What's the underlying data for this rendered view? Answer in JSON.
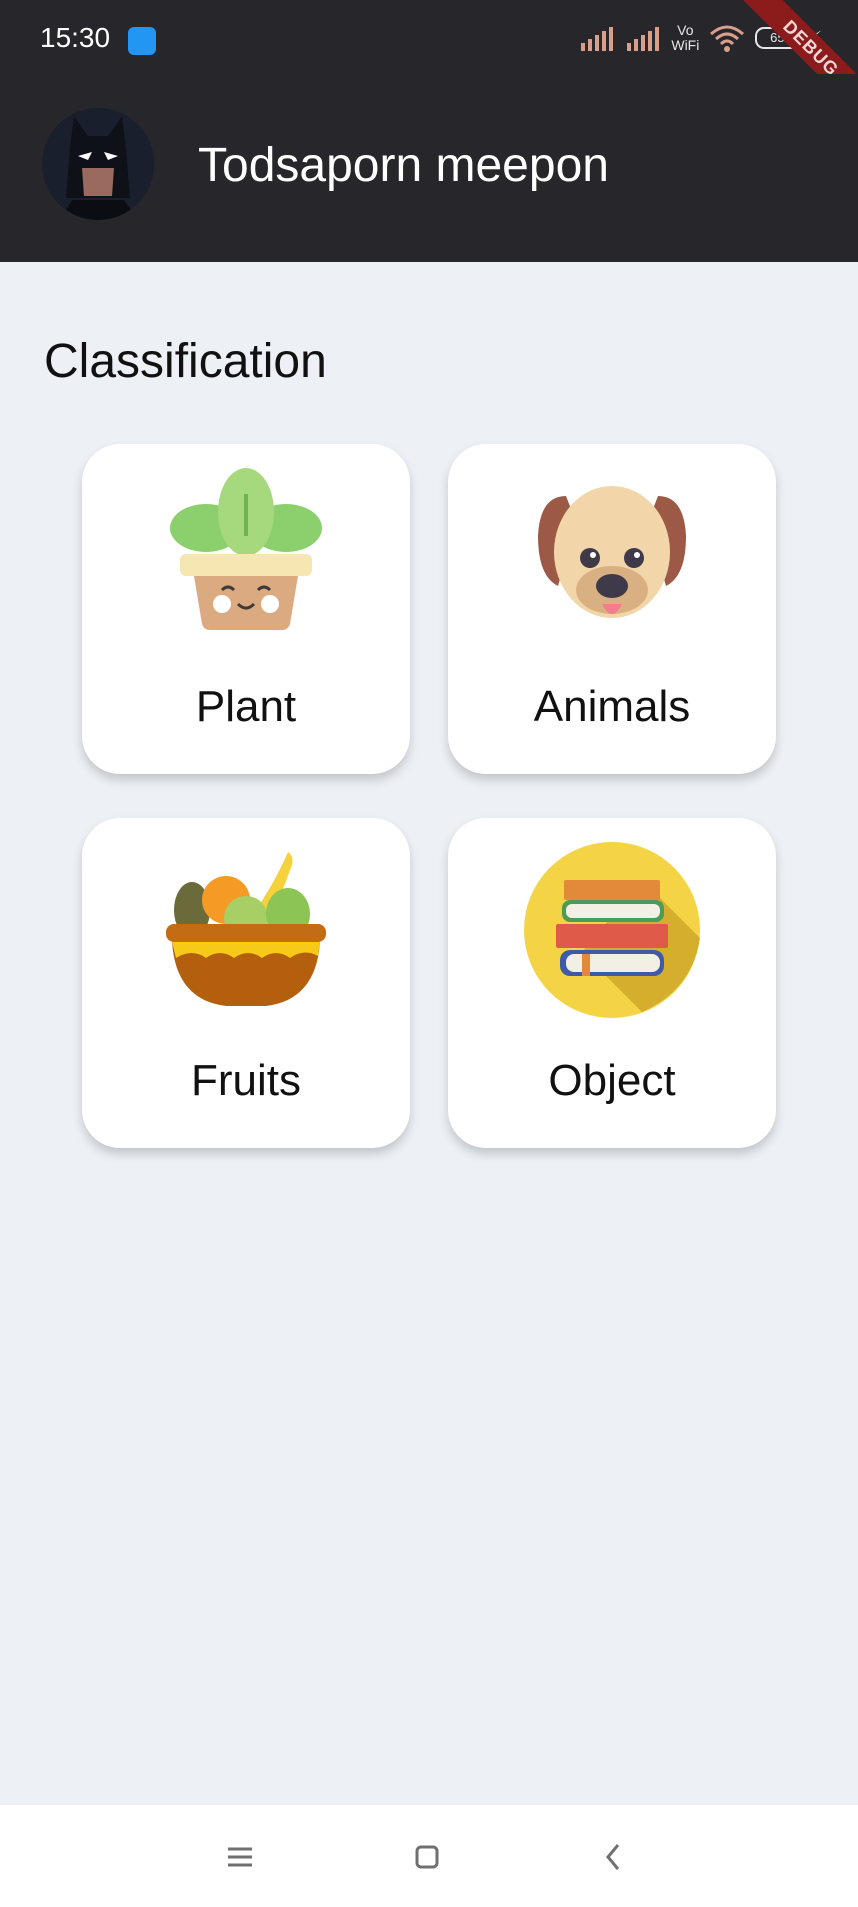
{
  "status_bar": {
    "time": "15:30",
    "vowifi_top": "Vo",
    "vowifi_bottom": "WiFi",
    "battery": "65",
    "debug_label": "DEBUG"
  },
  "app_bar": {
    "user_name": "Todsaporn meepon",
    "avatar_icon": "batman-avatar"
  },
  "main": {
    "section_title": "Classification",
    "categories": [
      {
        "label": "Plant",
        "icon": "potted-plant-icon"
      },
      {
        "label": "Animals",
        "icon": "dog-face-icon"
      },
      {
        "label": "Fruits",
        "icon": "fruit-basket-icon"
      },
      {
        "label": "Object",
        "icon": "books-icon"
      }
    ]
  },
  "colors": {
    "bar_background": "#26262b",
    "page_background": "#edf1f6",
    "card_background": "#ffffff",
    "debug_ribbon": "#8c1b1b"
  }
}
